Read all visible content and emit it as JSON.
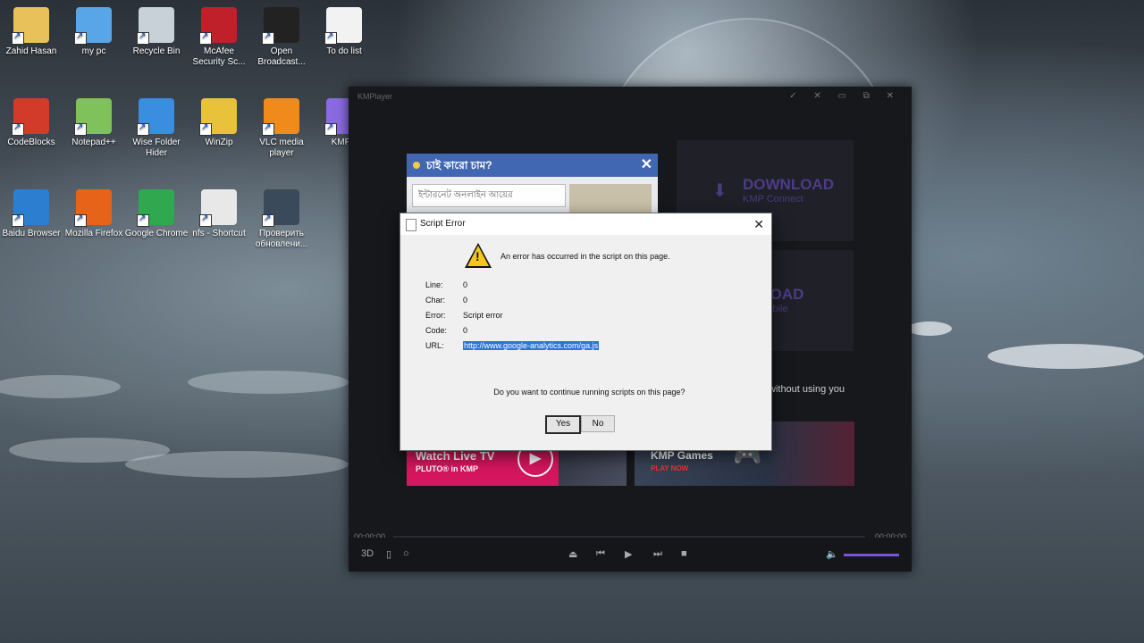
{
  "desktop": {
    "icons": [
      {
        "label": "Zahid Hasan",
        "color": "#e8c15a"
      },
      {
        "label": "my pc",
        "color": "#58a6e8"
      },
      {
        "label": "Recycle Bin",
        "color": "#c8d0d8"
      },
      {
        "label": "McAfee Security Sc...",
        "color": "#c0202a"
      },
      {
        "label": "Open Broadcast...",
        "color": "#222222"
      },
      {
        "label": "To do list",
        "color": "#f2f2f2"
      },
      {
        "label": "CodeBlocks",
        "color": "#d23a2a"
      },
      {
        "label": "Notepad++",
        "color": "#7fc15a"
      },
      {
        "label": "Wise Folder Hider",
        "color": "#3a8ee0"
      },
      {
        "label": "WinZip",
        "color": "#e8c23a"
      },
      {
        "label": "VLC media player",
        "color": "#f08a1a"
      },
      {
        "label": "KMP...",
        "color": "#8a6ae0"
      },
      {
        "label": "Baidu Browser",
        "color": "#2c7fd0"
      },
      {
        "label": "Mozilla Firefox",
        "color": "#e8631a"
      },
      {
        "label": "Google Chrome",
        "color": "#2fa84f"
      },
      {
        "label": "nfs - Shortcut",
        "color": "#e8e8e8"
      },
      {
        "label": "Проверить обновлени...",
        "color": "#3b4a5a"
      }
    ]
  },
  "kmp": {
    "title": "KMPlayer",
    "download_connect": {
      "big": "DOWNLOAD",
      "small": "KMP Connect"
    },
    "download_mobile": {
      "big": "NLOAD",
      "small": "P Mobile"
    },
    "partial_text": "without using you",
    "live_tv": {
      "title": "Watch Live TV",
      "sub": "PLUTO® in KMP"
    },
    "games": {
      "title": "KMP Games",
      "sub": "PLAY NOW"
    },
    "time_left": "00:00",
    "time_right": "00:00:00",
    "time_left_full": "00:00:00",
    "controls": {
      "label_3d": "3D"
    }
  },
  "fb_popup": {
    "title": "চাই কারো চাম?",
    "input_placeholder": "ইন্টারনেট অনলাইন আয়ের"
  },
  "dialog": {
    "title": "Script Error",
    "message": "An error has occurred in the script on this page.",
    "fields": [
      {
        "k": "Line:",
        "v": "0"
      },
      {
        "k": "Char:",
        "v": "0"
      },
      {
        "k": "Error:",
        "v": "Script error"
      },
      {
        "k": "Code:",
        "v": "0"
      },
      {
        "k": "URL:",
        "v": "http://www.google-analytics.com/ga.js"
      }
    ],
    "question": "Do you want to continue running scripts on this page?",
    "yes": "Yes",
    "no": "No"
  }
}
